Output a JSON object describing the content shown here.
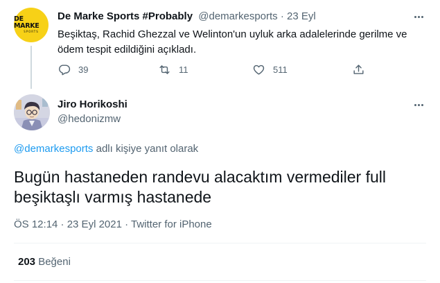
{
  "parent_tweet": {
    "avatar": {
      "line1": "DE MARKE",
      "line2": "SPORTS",
      "color": "#f7d117"
    },
    "display_name": "De Marke Sports #Probably",
    "handle": "@demarkesports",
    "separator": " · ",
    "date": "23 Eyl",
    "text": "Beşiktaş, Rachid Ghezzal ve Welinton'un uyluk arka adalelerinde gerilme ve ödem tespit edildiğini açıkladı.",
    "actions": {
      "reply": {
        "icon": "reply-icon",
        "count": "39"
      },
      "retweet": {
        "icon": "retweet-icon",
        "count": "11"
      },
      "like": {
        "icon": "heart-icon",
        "count": "511"
      },
      "share": {
        "icon": "share-icon"
      }
    }
  },
  "reply_tweet": {
    "avatar": {
      "icon": "anime-character-avatar"
    },
    "display_name": "Jiro Horikoshi",
    "handle": "@hedonizmw",
    "replying_mention": "@demarkesports",
    "replying_suffix": " adlı kişiye yanıt olarak",
    "text": "Bugün hastaneden randevu alacaktım vermediler full beşiktaşlı  varmış hastanede",
    "timestamp": "ÖS 12:14 · 23 Eyl 2021 · Twitter for iPhone",
    "likes_count": "203",
    "likes_label": "Beğeni"
  },
  "colors": {
    "text": "#0f1419",
    "secondary": "#536471",
    "link": "#1d9bf0",
    "divider": "#eff3f4",
    "thread_line": "#cfd9de"
  }
}
